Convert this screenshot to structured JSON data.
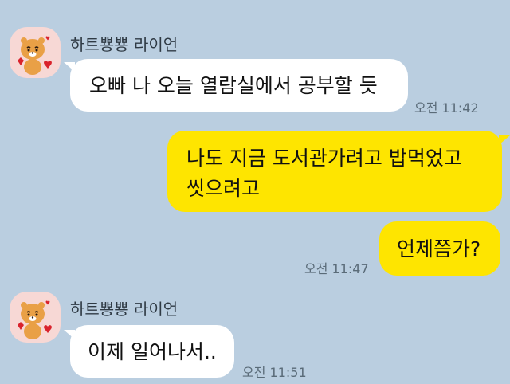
{
  "theme": {
    "background": "#bacee0",
    "incoming_bubble": "#ffffff",
    "outgoing_bubble": "#fee500"
  },
  "messages": [
    {
      "direction": "incoming",
      "sender": "하트뿅뿅 라이언",
      "avatar_icon": "ryan-lion-heart-icon",
      "lines": [
        "오빠 나 오늘 열람실에서 공부할 듯"
      ],
      "time": "오전 11:42"
    },
    {
      "direction": "outgoing",
      "lines": [
        "나도 지금 도서관가려고 밥먹었고",
        "씻으려고"
      ],
      "time": ""
    },
    {
      "direction": "outgoing",
      "lines": [
        "언제쯤가?"
      ],
      "time": "오전 11:47"
    },
    {
      "direction": "incoming",
      "sender": "하트뿅뿅 라이언",
      "avatar_icon": "ryan-lion-heart-icon",
      "lines": [
        "이제 일어나서.."
      ],
      "time": "오전 11:51"
    }
  ]
}
